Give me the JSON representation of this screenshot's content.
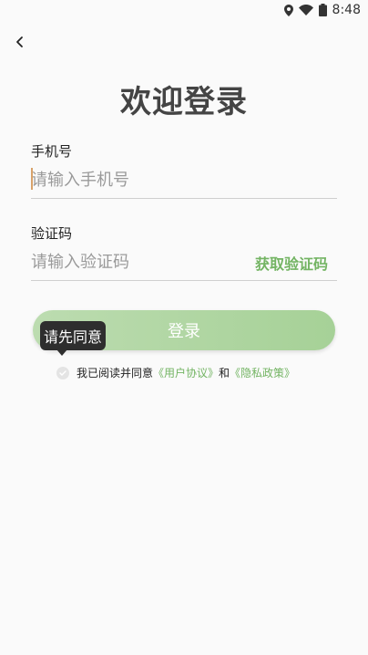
{
  "status_bar": {
    "time": "8:48",
    "icons": [
      "location-icon",
      "wifi-icon",
      "battery-icon"
    ]
  },
  "header": {
    "back_icon": "chevron-left-icon"
  },
  "title": "欢迎登录",
  "phone": {
    "label": "手机号",
    "placeholder": "请输入手机号",
    "value": ""
  },
  "code": {
    "label": "验证码",
    "placeholder": "请输入验证码",
    "value": "",
    "get_code_label": "获取验证码"
  },
  "login_button": "登录",
  "tooltip": "请先同意",
  "agreement": {
    "prefix": "我已阅读并同意",
    "user_agreement": "《用户协议》",
    "connector": "和",
    "privacy_policy": "《隐私政策》",
    "checked": false
  },
  "colors": {
    "accent": "#73b463",
    "button_gradient_start": "#bcdcb0",
    "button_gradient_end": "#a6d197",
    "tooltip_bg": "#2e2e2e",
    "background": "#fafafa"
  }
}
